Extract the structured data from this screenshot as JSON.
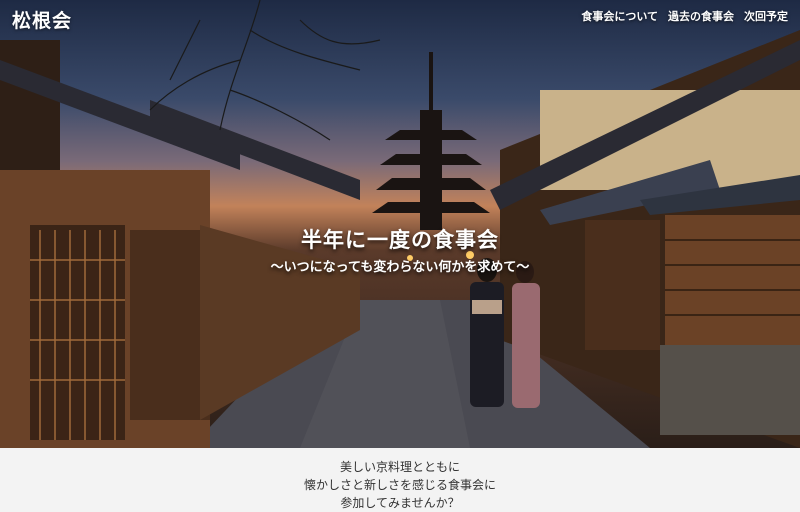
{
  "brand": {
    "title": "松根会"
  },
  "nav": {
    "items": [
      {
        "label": "食事会について"
      },
      {
        "label": "過去の食事会"
      },
      {
        "label": "次回予定"
      }
    ]
  },
  "hero": {
    "title": "半年に一度の食事会",
    "subtitle": "〜いつになっても変わらない何かを求めて〜"
  },
  "intro": {
    "lines": [
      "美しい京料理とともに",
      "懐かしさと新しさを感じる食事会に",
      "参加してみませんか？"
    ]
  },
  "colors": {
    "sky_top": "#1e2a44",
    "sunset": "#c2825a",
    "wood": "#5a3a2a",
    "intro_bg": "#f3f3f3"
  }
}
